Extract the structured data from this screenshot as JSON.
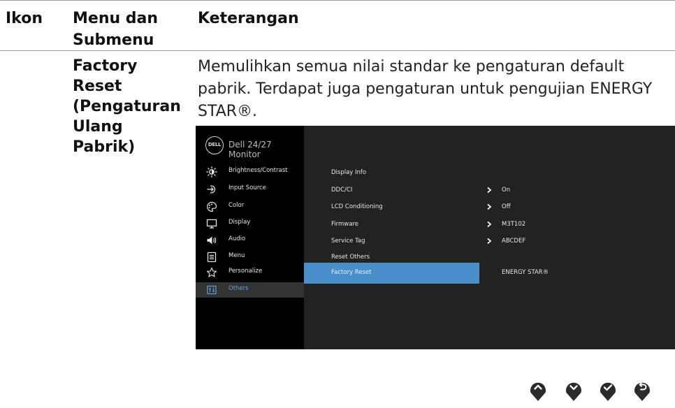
{
  "table": {
    "headers": [
      "Ikon",
      "Menu dan\nSubmenu",
      "Keterangan"
    ],
    "menu_name": "Factory\nReset\n(Pengaturan\nUlang\nPabrik)",
    "description": "Memulihkan semua nilai standar ke pengaturan default pabrik. Terdapat juga pengaturan untuk pengujian ENERGY STAR®."
  },
  "osd": {
    "logo": "DELL",
    "title": "Dell 24/27 Monitor",
    "nav_items": [
      {
        "label": "Brightness/Contrast",
        "icon": "brightness-icon"
      },
      {
        "label": "Input Source",
        "icon": "input-source-icon"
      },
      {
        "label": "Color",
        "icon": "color-palette-icon"
      },
      {
        "label": "Display",
        "icon": "display-icon"
      },
      {
        "label": "Audio",
        "icon": "speaker-icon"
      },
      {
        "label": "Menu",
        "icon": "menu-icon"
      },
      {
        "label": "Personalize",
        "icon": "star-icon"
      },
      {
        "label": "Others",
        "icon": "others-icon"
      }
    ],
    "active_nav": "Others",
    "sub_items": [
      {
        "label": "Display Info",
        "value": ""
      },
      {
        "label": "DDC/CI",
        "value": "On"
      },
      {
        "label": "LCD Conditioning",
        "value": "Off"
      },
      {
        "label": "Firmware",
        "value": "M3T102"
      },
      {
        "label": "Service Tag",
        "value": "ABCDEF"
      },
      {
        "label": "Reset Others",
        "value": ""
      },
      {
        "label": "Factory Reset",
        "value": "ENERGY STAR®"
      }
    ],
    "selected_sub": "Factory Reset",
    "highlight_color": "#4a8fcc",
    "active_text_color": "#5aa0e0"
  },
  "buttons": [
    {
      "name": "up-button",
      "icon": "chevron-up-icon"
    },
    {
      "name": "down-button",
      "icon": "chevron-down-icon"
    },
    {
      "name": "ok-button",
      "icon": "check-icon"
    },
    {
      "name": "back-button",
      "icon": "back-arrow-icon"
    }
  ]
}
